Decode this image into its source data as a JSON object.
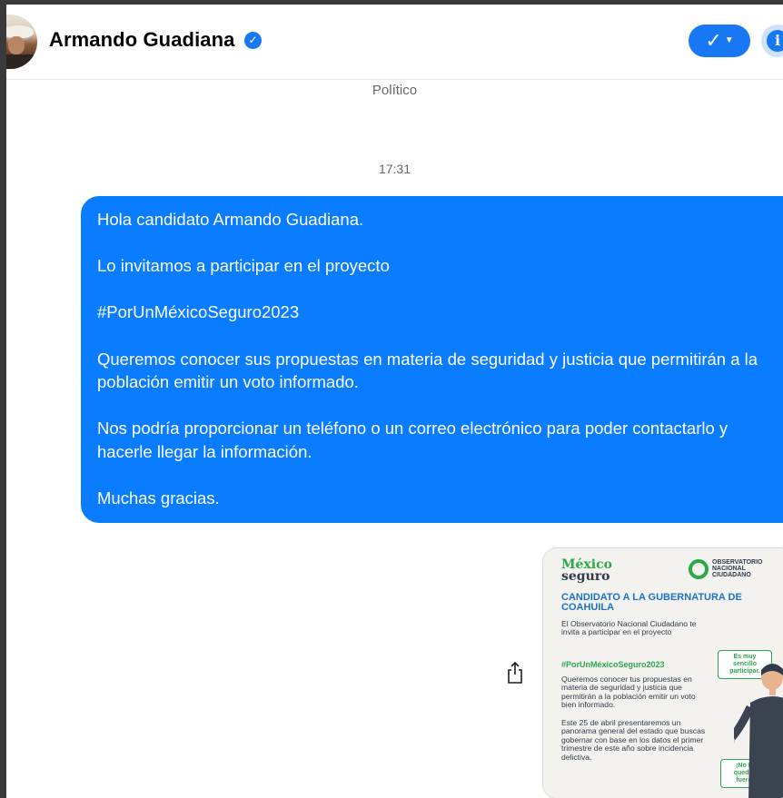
{
  "header": {
    "contact_name": "Armando Guadiana",
    "verified_icon": "verified-check-icon",
    "status_button_icons": [
      "check-icon",
      "caret-down-icon"
    ],
    "info_icon": "info-icon"
  },
  "thread": {
    "subtitle": "Político",
    "timestamp": "17:31",
    "message": {
      "paragraphs": [
        "Hola candidato Armando Guadiana.",
        "Lo invitamos a participar en el proyecto",
        "#PorUnMéxicoSeguro2023",
        "Queremos conocer sus propuestas en materia de seguridad y justicia que permitirán a la población emitir un voto informado.",
        "Nos podría proporcionar un teléfono o un correo electrónico para poder contactarlo y hacerle llegar la información.",
        "Muchas gracias."
      ]
    },
    "share_icon": "share-icon",
    "attachment": {
      "logo_line1": "México",
      "logo_line2": "seguro",
      "org_line1": "OBSERVATORIO",
      "org_line2": "NACIONAL",
      "org_line3": "CIUDADANO",
      "title": "CANDIDATO A LA GUBERNATURA DE COAHUILA",
      "intro": "El Observatorio Nacional Ciudadano te invita a participar en el proyecto",
      "hashtag": "#PorUnMéxicoSeguro2023",
      "body1": "Queremos conocer tus propuestas en materia de seguridad y justicia que permitirán a la población emitir un voto bien informado.",
      "body2": "Este 25 de abril presentaremos un panorama general del estado que buscas gobernar con base en los datos el primer trimestre de este año sobre incidencia delictiva.",
      "bubble_top": "Es muy sencillo participar.",
      "bubble_bottom": "¡No te quedes fuera!"
    }
  },
  "colors": {
    "accent": "#1877f2",
    "bubble": "#0a7cff",
    "poster_green": "#2aa84a",
    "poster_blue": "#1a73c7"
  }
}
